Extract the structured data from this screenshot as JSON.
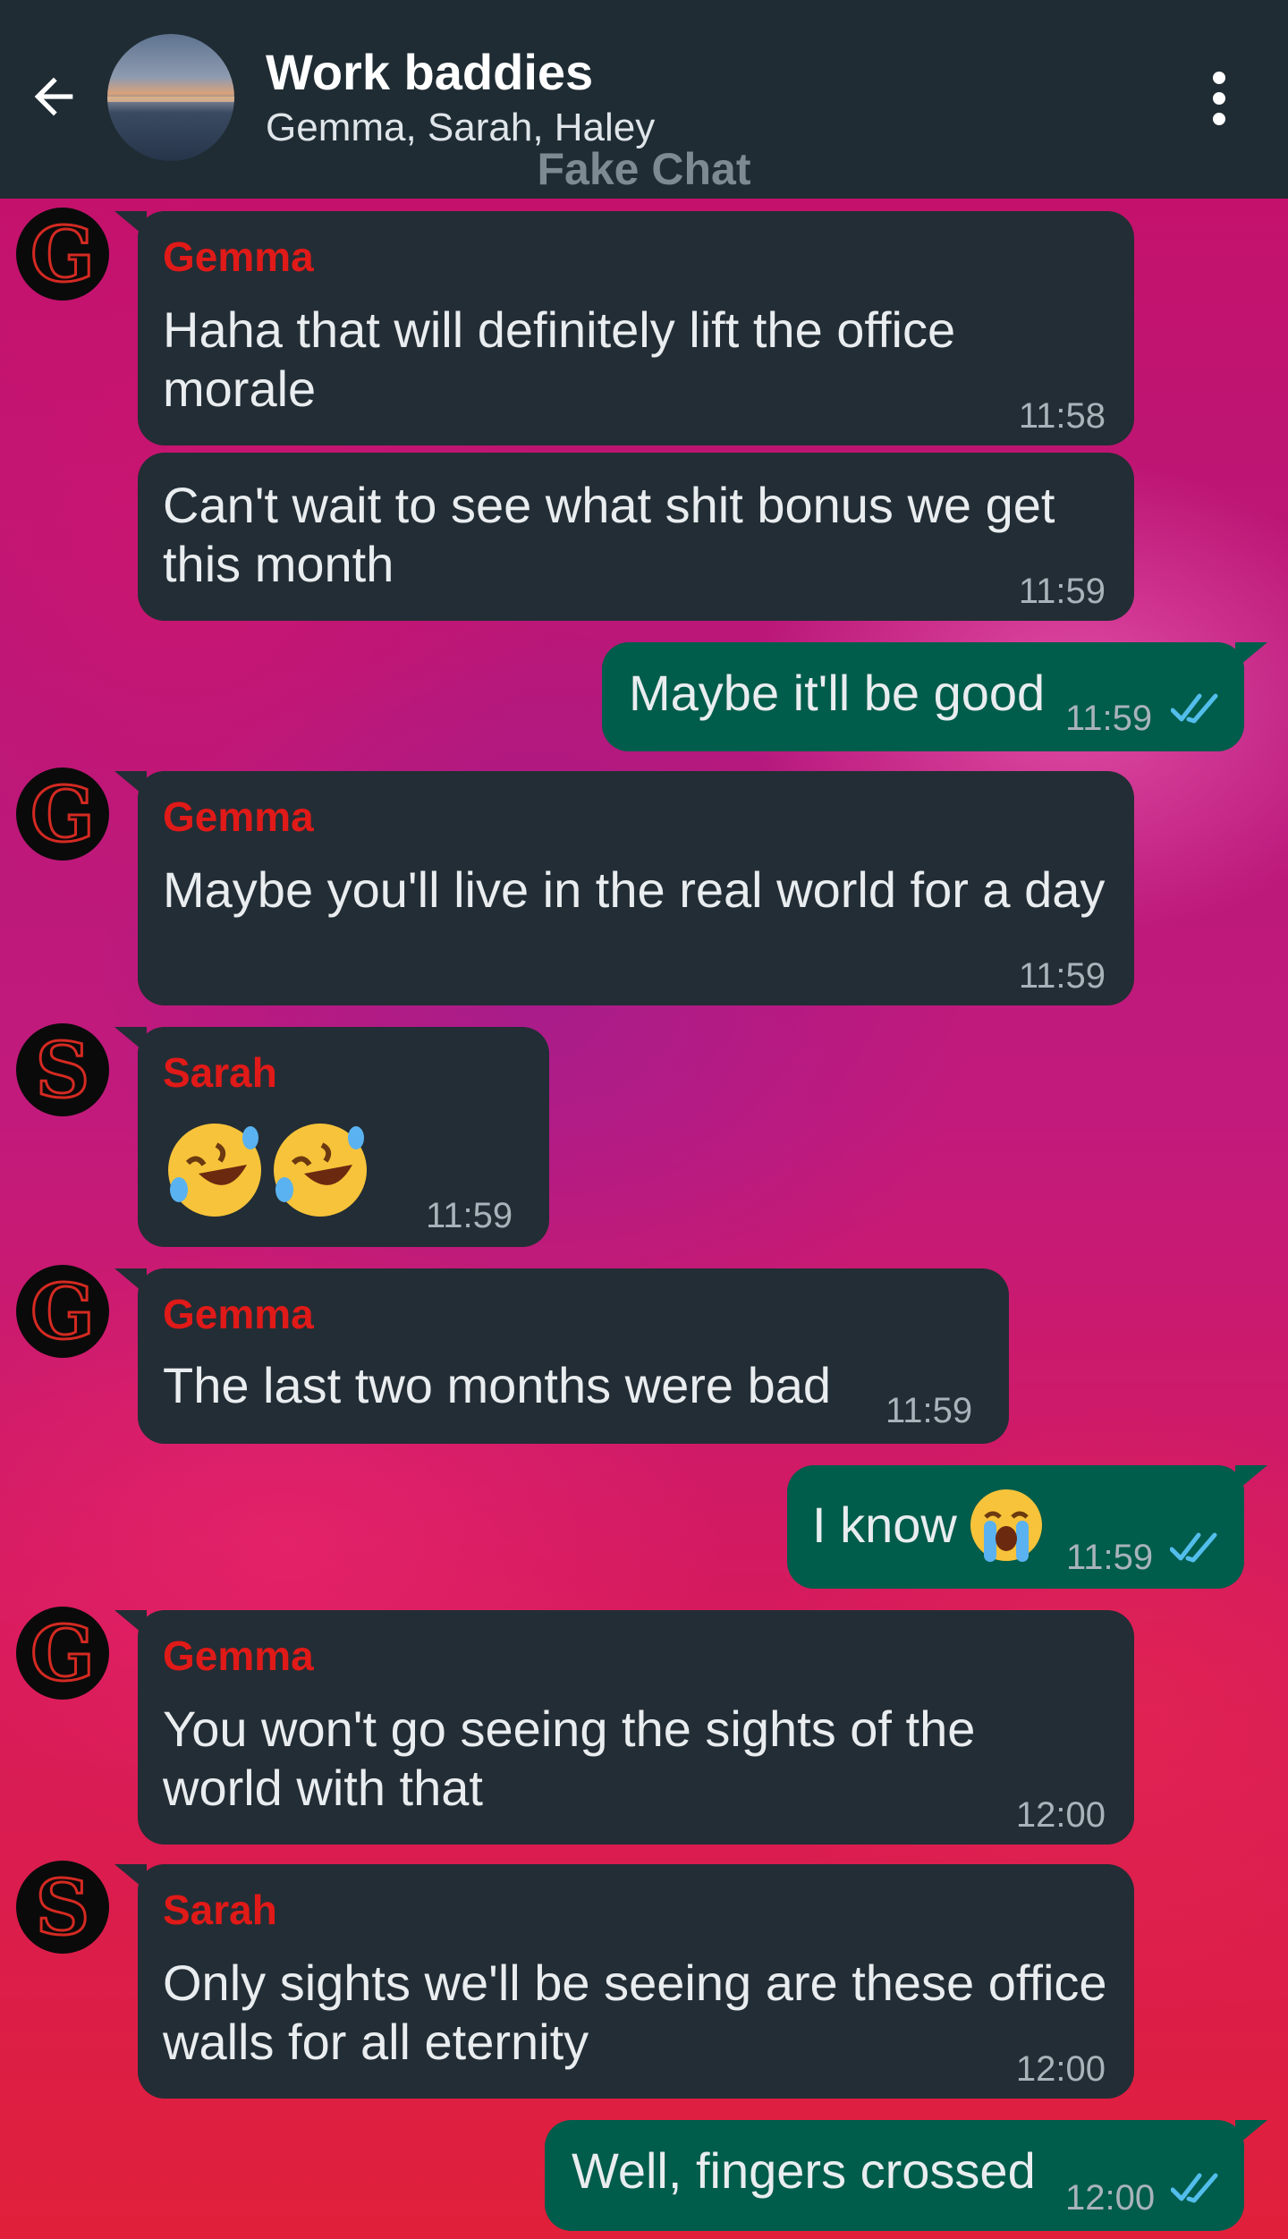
{
  "header": {
    "title": "Work baddies",
    "subtitle": "Gemma, Sarah, Haley",
    "watermark": "Fake Chat",
    "back_icon": "arrow-left-icon",
    "menu_icon": "more-vertical-icon"
  },
  "colors": {
    "header_bg": "#1f2c34",
    "incoming_bubble": "#232d35",
    "outgoing_bubble": "#005c4b",
    "sender_name": "#e01a18",
    "read_ticks": "#53bdeb"
  },
  "messages": [
    {
      "sender": "Gemma",
      "avatar_letter": "G",
      "lines": [
        "Haha that will definitely lift the office",
        "morale"
      ],
      "time": "11:58"
    },
    {
      "lines": [
        "Can't wait to see what shit bonus we get",
        "this month"
      ],
      "time": "11:59"
    },
    {
      "lines": [
        "Maybe it'll be good"
      ],
      "time": "11:59",
      "outgoing": true
    },
    {
      "sender": "Gemma",
      "avatar_letter": "G",
      "lines": [
        "Maybe you'll live in the real world for a day"
      ],
      "time": "11:59"
    },
    {
      "sender": "Sarah",
      "avatar_letter": "S",
      "emoji": "rolling-on-floor-laughing x2",
      "time": "11:59"
    },
    {
      "sender": "Gemma",
      "avatar_letter": "G",
      "lines": [
        "The last two months were bad"
      ],
      "time": "11:59"
    },
    {
      "lines": [
        "I know"
      ],
      "emoji": "loudly-crying-face",
      "time": "11:59",
      "outgoing": true
    },
    {
      "sender": "Gemma",
      "avatar_letter": "G",
      "lines": [
        "You won't go seeing the sights of the",
        "world with that"
      ],
      "time": "12:00"
    },
    {
      "sender": "Sarah",
      "avatar_letter": "S",
      "lines": [
        "Only sights we'll be seeing are these office",
        "walls for all eternity"
      ],
      "time": "12:00"
    },
    {
      "lines": [
        "Well, fingers crossed"
      ],
      "time": "12:00",
      "outgoing": true
    }
  ]
}
